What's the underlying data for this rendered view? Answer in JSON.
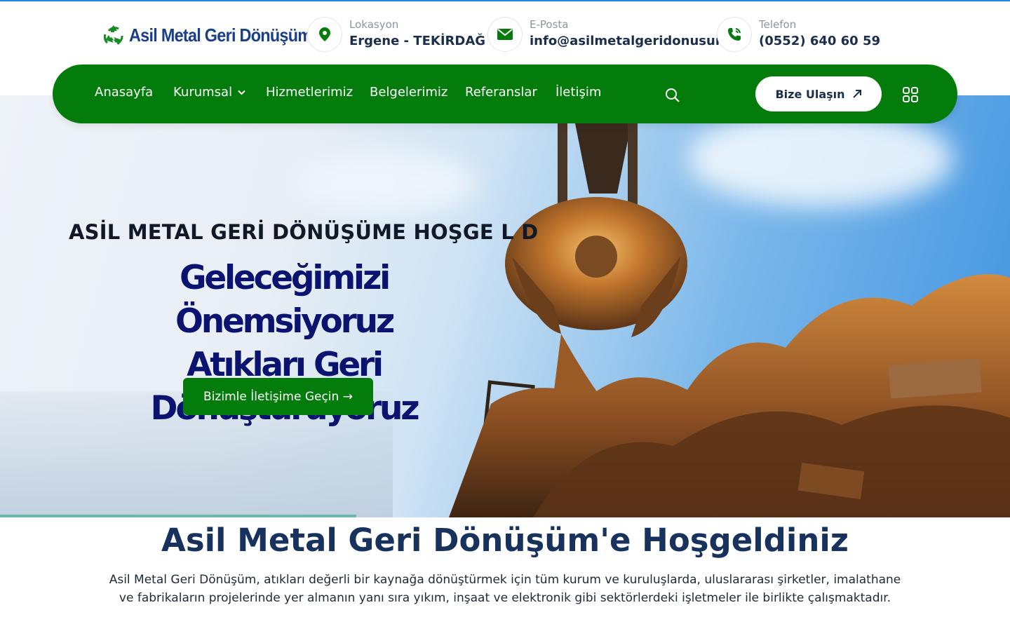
{
  "brand": {
    "name": "Asil Metal Geri Dönüşüm",
    "color": "#047c0c",
    "text_color": "#183f88"
  },
  "contact_info": [
    {
      "icon": "location-pin-icon",
      "label": "Lokasyon",
      "value": "Ergene - TEKİRDAĞ"
    },
    {
      "icon": "envelope-icon",
      "label": "E-Posta",
      "value": "info@asilmetalgeridonusum"
    },
    {
      "icon": "phone-icon",
      "label": "Telefon",
      "value": "(0552) 640 60 59"
    }
  ],
  "nav": {
    "items": [
      {
        "label": "Anasayfa"
      },
      {
        "label": "Kurumsal",
        "has_dropdown": true
      },
      {
        "label": "Hizmetlerimiz"
      },
      {
        "label": "Belgelerimiz"
      },
      {
        "label": "Referanslar"
      },
      {
        "label": "İletişim"
      }
    ],
    "contact_button": "Bize Ulaşın",
    "search_icon": "search-icon",
    "menu_icon": "grid-menu-icon",
    "background": "#047c0c"
  },
  "hero": {
    "subtitle": "ASİL METAL GERİ DÖNÜŞÜME HOŞGE L    D",
    "title_line1": "Geleceğimizi Önemsiyoruz",
    "title_line2": "Atıkları Geri Dönüştürüyoruz",
    "button": "Bizimle İletişime Geçin →",
    "title_color": "#0b1370"
  },
  "welcome": {
    "title": "Asil Metal Geri Dönüşüm'e Hoşgeldiniz",
    "text": "Asil Metal Geri Dönüşüm, atıkları değerli bir kaynağa dönüştürmek için tüm kurum ve kuruluşlarda, uluslararası şirketler, imalathane ve fabrikaların projelerinde yer almanın yanı sıra yıkım, inşaat ve elektronik gibi sektörlerdeki işletmeler ile birlikte çalışmaktadır."
  }
}
